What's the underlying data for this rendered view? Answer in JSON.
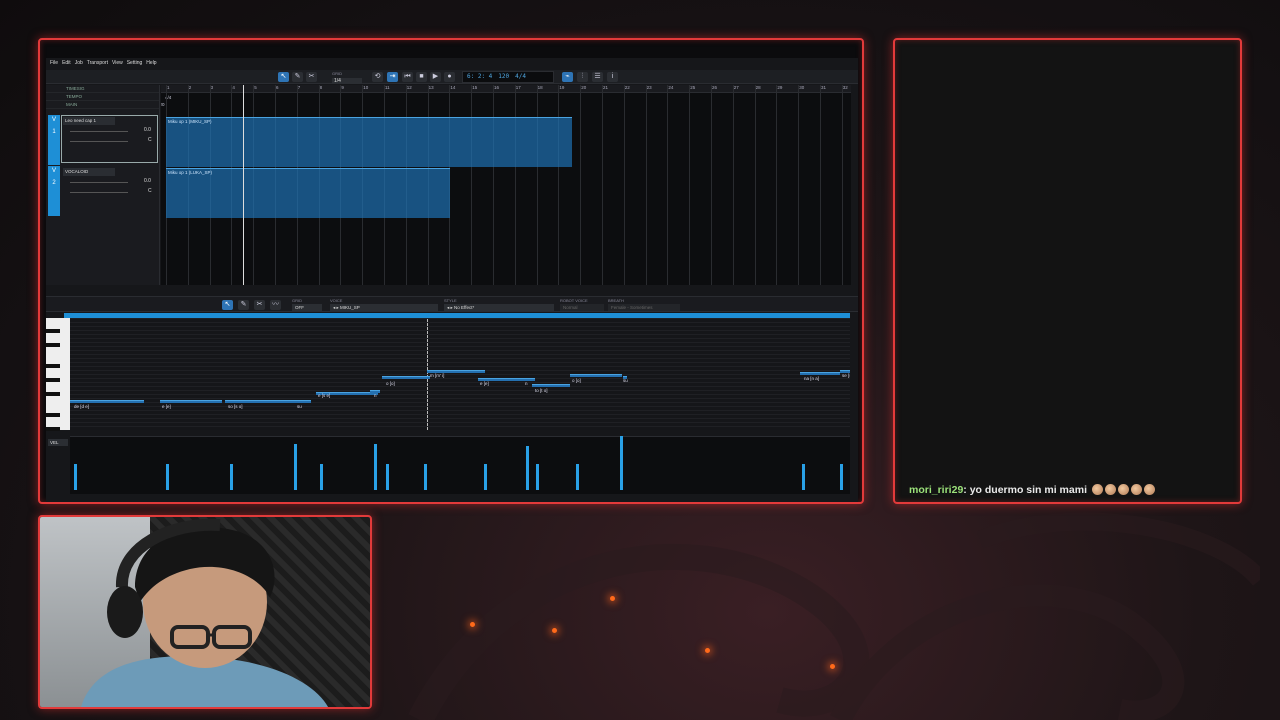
{
  "daw": {
    "menu": [
      "File",
      "Edit",
      "Job",
      "Transport",
      "View",
      "Setting",
      "Help"
    ],
    "grid": {
      "label": "GRID",
      "value": "1/4"
    },
    "lcd": {
      "position": "6: 2: 4",
      "tempo": "120",
      "timesig": "4/4"
    },
    "header_rows": [
      "TIMESIG",
      "TEMPO",
      "MAIN"
    ],
    "timesig_value": "4/4",
    "tempo_value": "120",
    "ruler_numbers": [
      "1",
      "2",
      "3",
      "4",
      "5",
      "6",
      "7",
      "8",
      "9",
      "10",
      "11",
      "12",
      "13",
      "14",
      "15",
      "16",
      "17",
      "18",
      "19",
      "20",
      "21",
      "22",
      "23",
      "24",
      "25",
      "26",
      "27",
      "28",
      "29",
      "30",
      "31",
      "32"
    ],
    "tracks": [
      {
        "tag": "V",
        "number": "1",
        "name": "Leo need cap 1",
        "value_a": "0.0",
        "value_b": "C",
        "part": "Miku op 1 (MIKU_SP)"
      },
      {
        "tag": "V",
        "number": "2",
        "name": "VOCALOID",
        "value_a": "0.0",
        "value_b": "C",
        "part": "Miku op 1 (LUKA_SP)"
      }
    ],
    "piano_roll": {
      "grid": {
        "label": "GRID",
        "value": "OFF"
      },
      "voice": {
        "label": "VOICE",
        "value": "◂ ▸ MIKU_SP"
      },
      "style": {
        "label": "STYLE",
        "value": "◂ ▸ No Effect*"
      },
      "robot_voice": {
        "label": "ROBOT VOICE",
        "value": "Normal"
      },
      "breath": {
        "label": "BREATH",
        "value": "Female - Sometimes"
      },
      "vel_label": "VEL",
      "lyrics": [
        "de [d e]",
        "e [e]",
        "so [s o]",
        "su",
        "e [s e]",
        "n",
        "o [o]",
        "m [m' i]",
        "e [e]",
        "n",
        "to [t o]",
        "o [o]",
        "su",
        "na [n a]",
        "se [s"
      ]
    }
  },
  "chat": {
    "username": "mori_riri29",
    "message": "yo duermo sin mi mami"
  },
  "colors": {
    "frame_accent": "#e23a3a",
    "part_blue": "#1e78be",
    "chat_user": "#9be27a"
  }
}
